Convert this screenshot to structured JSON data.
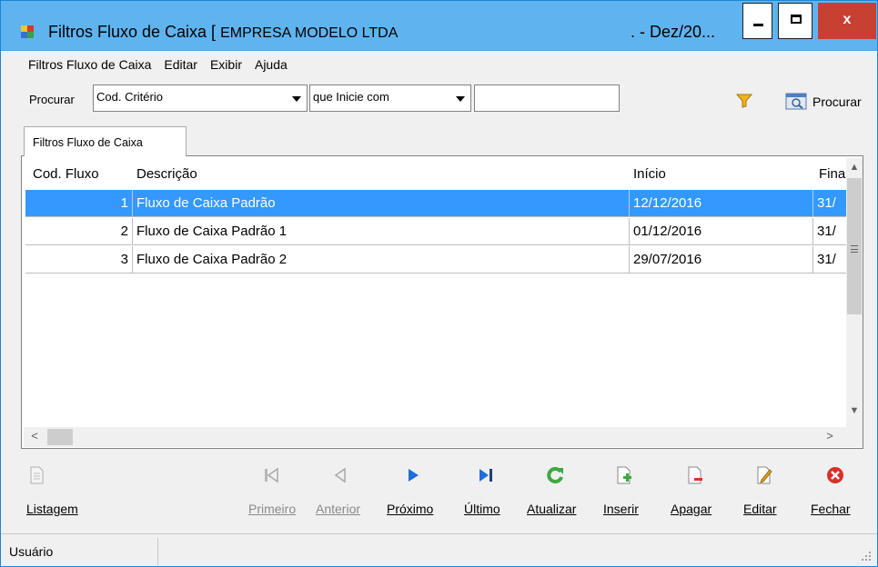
{
  "window": {
    "title_prefix": "Filtros Fluxo de Caixa [",
    "title_company": "EMPRESA MODELO LTDA",
    "title_suffix": ". - Dez/20..."
  },
  "menu": [
    "Filtros Fluxo de Caixa",
    "Editar",
    "Exibir",
    "Ajuda"
  ],
  "search": {
    "label": "Procurar",
    "field_value": "Cod. Critério",
    "condition_value": "que Inicie com",
    "text_value": "",
    "button_label": "Procurar"
  },
  "tab": {
    "label": "Filtros Fluxo de Caixa"
  },
  "grid": {
    "columns": [
      "Cod. Fluxo",
      "Descrição",
      "Início",
      "Fina"
    ],
    "rows": [
      {
        "cod": "1",
        "descricao": "Fluxo de Caixa Padrão",
        "inicio": "12/12/2016",
        "fim": "31/"
      },
      {
        "cod": "2",
        "descricao": "Fluxo de Caixa Padrão 1",
        "inicio": "01/12/2016",
        "fim": "31/"
      },
      {
        "cod": "3",
        "descricao": "Fluxo de Caixa Padrão 2",
        "inicio": "29/07/2016",
        "fim": "31/"
      }
    ],
    "selected_row": 0
  },
  "toolbar": {
    "listagem": "Listagem",
    "primeiro": "Primeiro",
    "anterior": "Anterior",
    "proximo": "Próximo",
    "ultimo": "Último",
    "atualizar": "Atualizar",
    "inserir": "Inserir",
    "apagar": "Apagar",
    "editar": "Editar",
    "fechar": "Fechar"
  },
  "status": {
    "user_label": "Usuário"
  },
  "colors": {
    "titlebar": "#5fb4f0",
    "selection": "#3399ff",
    "close_button": "#c84031",
    "accent_icon": "#1e6fd9"
  }
}
